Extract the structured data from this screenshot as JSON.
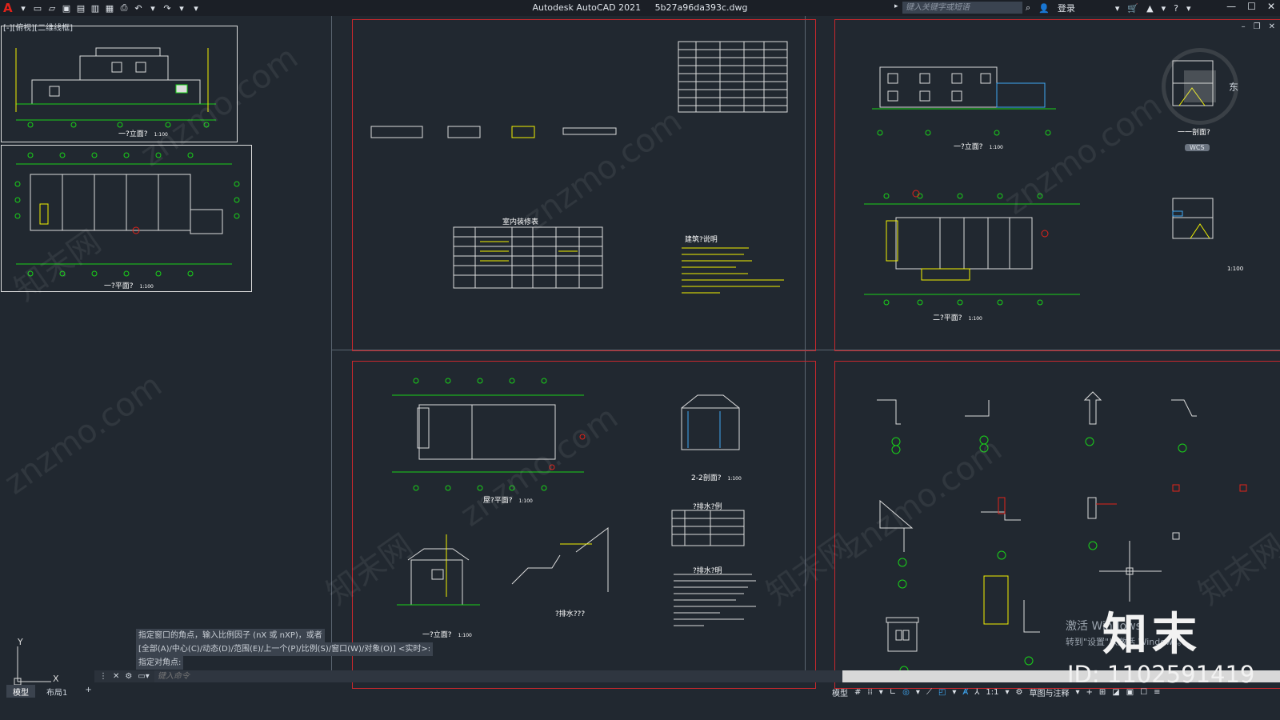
{
  "titlebar": {
    "app": "Autodesk AutoCAD 2021",
    "file": "5b27a96da393c.dwg",
    "search_placeholder": "键入关键字或短语",
    "login": "登录"
  },
  "viewport": {
    "label": "[-][俯视][二维线框]"
  },
  "sheets": {
    "upper_left_caption": "一?立面?",
    "upper_left_scale": "1:100",
    "lower_left_caption": "一?平面?",
    "lower_left_scale": "1:100",
    "table1_caption": "室内装修表",
    "notes1_caption": "建筑?说明",
    "elev2_caption": "一?立面?",
    "elev2_scale": "1:100",
    "sec1_caption": "一一剖面?",
    "plan2_caption": "二?平面?",
    "plan2_scale": "1:100",
    "sec2_scale": "1:100",
    "roof_caption": "屋?平面?",
    "roof_scale": "1:100",
    "sec22_caption": "2-2剖面?",
    "sec22_scale": "1:100",
    "table2_caption": "?排水?例",
    "elev3_caption": "一?立面?",
    "elev3_scale": "1:100",
    "detail_caption": "?排水???",
    "notes2_caption": "?排水?明"
  },
  "command": {
    "history": [
      "指定窗口的角点，输入比例因子 (nX 或 nXP)，或者",
      "[全部(A)/中心(C)/动态(D)/范围(E)/上一个(P)/比例(S)/窗口(W)/对象(O)] <实时>:",
      "指定对角点:"
    ],
    "placeholder": "键入命令"
  },
  "tabs": [
    "模型",
    "布局1"
  ],
  "status": {
    "model": "模型",
    "scale": "1:1",
    "workspace": "草图与注释"
  },
  "navigation": {
    "east": "东",
    "wcs": "WCS"
  },
  "ucs": {
    "x": "X",
    "y": "Y"
  },
  "overlay": {
    "activate_line1": "激活 Windows",
    "activate_line2": "转到\"设置\"以激活 Windows。",
    "brand": "知末",
    "id": "ID: 1102591419",
    "watermark": "znzmo.com",
    "watermark_cn": "知末网"
  },
  "colors": {
    "background": "#212830",
    "frame_red": "#c8282d",
    "line_green": "#19d219",
    "line_yellow": "#f2f200",
    "accent_blue": "#3fa9f5"
  }
}
